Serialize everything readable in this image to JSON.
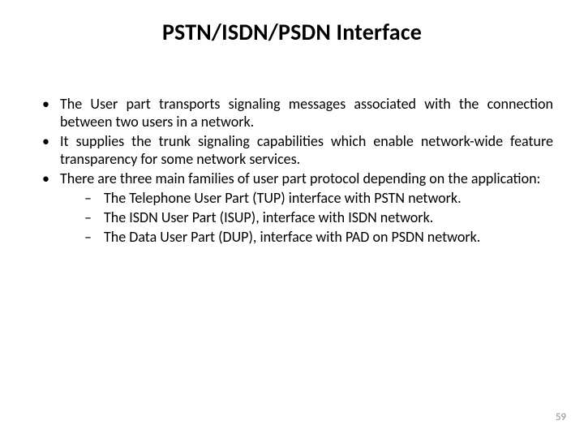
{
  "title": "PSTN/ISDN/PSDN Interface",
  "bullets": [
    {
      "text": "The User part transports signaling messages associated with the connection between two users in a network.",
      "children": []
    },
    {
      "text": "It supplies the trunk signaling capabilities which enable network-wide feature transparency for some network services.",
      "children": []
    },
    {
      "text": "There are three main families of user part protocol depending on the application:",
      "children": [
        "The Telephone User Part (TUP) interface with PSTN network.",
        "The ISDN User Part (ISUP), interface with ISDN network.",
        "The Data User Part (DUP), interface with PAD on PSDN network."
      ]
    }
  ],
  "page_number": "59"
}
